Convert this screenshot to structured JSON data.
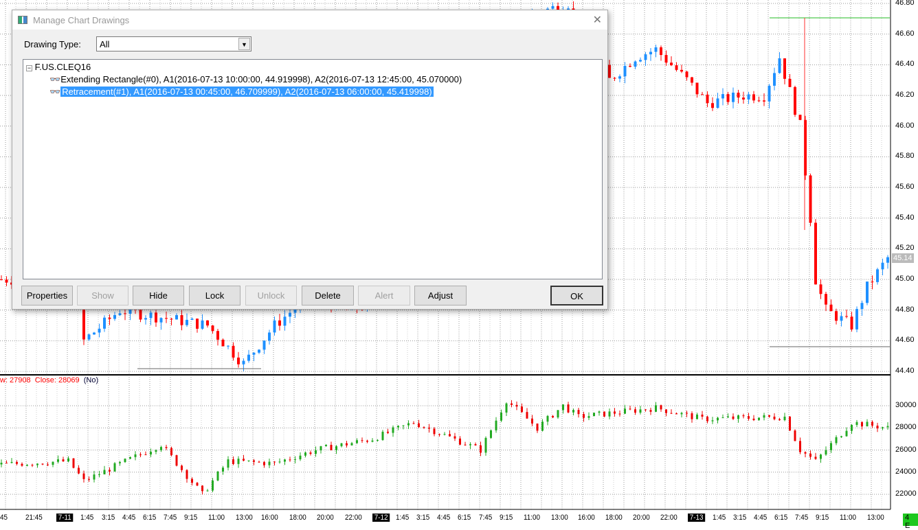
{
  "dialog": {
    "title": "Manage Chart Drawings",
    "drawing_type_label": "Drawing Type:",
    "drawing_type_value": "All",
    "tree": {
      "root": "F.US.CLEQ16",
      "items": [
        {
          "label": "Extending Rectangle(#0), A1(2016-07-13  10:00:00, 44.919998), A2(2016-07-13  12:45:00, 45.070000)",
          "selected": false
        },
        {
          "label": "Retracement(#1), A1(2016-07-13  00:45:00, 46.709999), A2(2016-07-13  06:00:00, 45.419998)",
          "selected": true
        }
      ]
    },
    "buttons": {
      "properties": "Properties",
      "show": "Show",
      "hide": "Hide",
      "lock": "Lock",
      "unlock": "Unlock",
      "delete": "Delete",
      "alert": "Alert",
      "adjust": "Adjust",
      "ok": "OK"
    }
  },
  "price_axis": [
    "46.80",
    "46.60",
    "46.40",
    "46.20",
    "46.00",
    "45.80",
    "45.60",
    "45.40",
    "45.20",
    "45.00",
    "44.80",
    "44.60",
    "44.40"
  ],
  "last_price": "45.14",
  "volume_axis": [
    "30000",
    "28000",
    "26000",
    "24000",
    "22000"
  ],
  "lower_header": {
    "values": "w: 27908  Close: 28069",
    "mode": "(No)"
  },
  "time_axis": [
    "45",
    "21:45",
    "7-11",
    "1:45",
    "3:15",
    "4:45",
    "6:15",
    "7:45",
    "9:15",
    "11:00",
    "13:00",
    "16:00",
    "18:00",
    "20:00",
    "22:00",
    "7-12",
    "1:45",
    "3:15",
    "4:45",
    "6:15",
    "7:45",
    "9:15",
    "11:00",
    "13:00",
    "16:00",
    "18:00",
    "20:00",
    "22:00",
    "7-13",
    "1:45",
    "3:15",
    "4:45",
    "6:15",
    "7:45",
    "9:15",
    "11:00",
    "13:00"
  ],
  "end_marker": "4 E",
  "colors": {
    "up": "#1e90ff",
    "down": "#ff0000",
    "neutral": "#555555",
    "vol_up": "#22aa22",
    "vol_down": "#ee0000"
  },
  "price_path": [
    [
      0,
      45.0
    ],
    [
      15,
      45.0
    ],
    [
      16,
      44.6
    ],
    [
      23,
      44.8
    ],
    [
      40,
      44.7
    ],
    [
      47,
      44.45
    ],
    [
      53,
      44.7
    ],
    [
      60,
      44.9
    ],
    [
      67,
      44.8
    ],
    [
      72,
      44.85
    ],
    [
      85,
      45.4
    ],
    [
      100,
      46.7
    ],
    [
      110,
      46.8
    ],
    [
      118,
      46.3
    ],
    [
      123,
      46.45
    ],
    [
      127,
      46.5
    ],
    [
      133,
      46.3
    ],
    [
      137,
      46.15
    ],
    [
      144,
      46.2
    ],
    [
      148,
      46.2
    ],
    [
      151,
      46.45
    ],
    [
      155,
      46.0
    ],
    [
      157,
      45.4
    ],
    [
      158,
      45.0
    ],
    [
      160,
      44.8
    ],
    [
      165,
      44.7
    ],
    [
      168,
      44.95
    ],
    [
      172,
      45.14
    ]
  ],
  "volume_path": [
    [
      0,
      24700
    ],
    [
      13,
      25000
    ],
    [
      16,
      23200
    ],
    [
      31,
      26500
    ],
    [
      39,
      22000
    ],
    [
      44,
      25000
    ],
    [
      53,
      24800
    ],
    [
      61,
      26000
    ],
    [
      72,
      27000
    ],
    [
      80,
      28500
    ],
    [
      93,
      26000
    ],
    [
      98,
      30500
    ],
    [
      104,
      28000
    ],
    [
      109,
      30000
    ],
    [
      112,
      29000
    ],
    [
      127,
      29800
    ],
    [
      136,
      28800
    ],
    [
      152,
      29000
    ],
    [
      155,
      26000
    ],
    [
      158,
      25000
    ],
    [
      165,
      28500
    ],
    [
      172,
      28000
    ]
  ]
}
